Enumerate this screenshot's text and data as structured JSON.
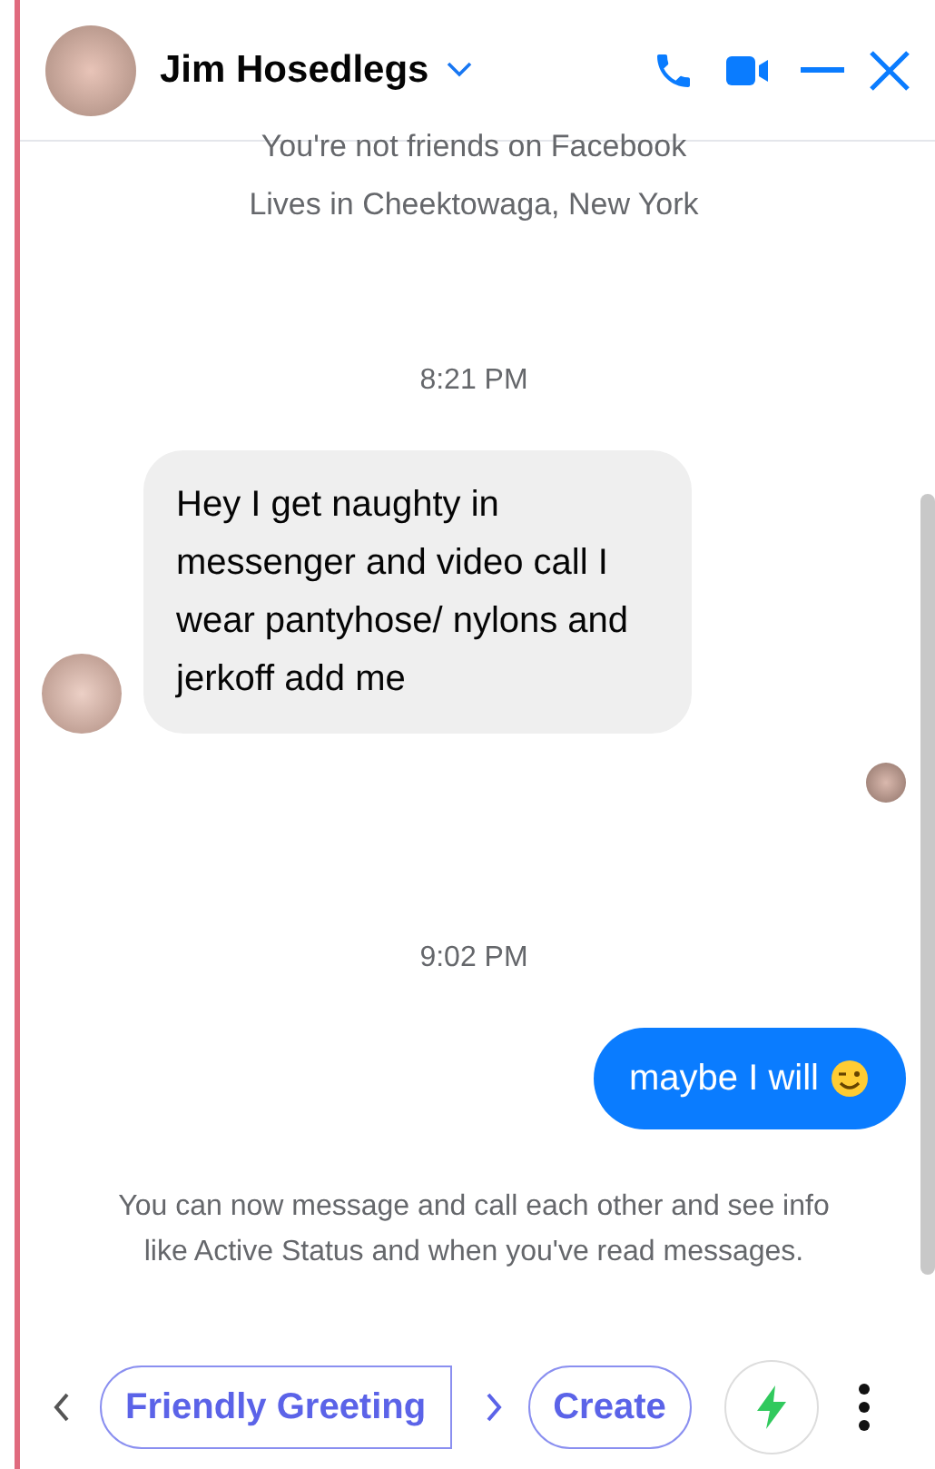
{
  "header": {
    "name": "Jim Hosedlegs"
  },
  "messages": [
    {
      "kind": "info",
      "text": "You're not friends on Facebook"
    },
    {
      "kind": "info",
      "text": "Lives in Cheektowaga, New York"
    },
    {
      "kind": "time",
      "text": "8:21 PM"
    },
    {
      "kind": "incoming",
      "text": "Hey I get naughty  in messenger and video call I wear pantyhose/ nylons and jerkoff add me"
    },
    {
      "kind": "seen"
    },
    {
      "kind": "time",
      "text": "9:02 PM"
    },
    {
      "kind": "outgoing",
      "text": "maybe I will"
    },
    {
      "kind": "notice",
      "text": "You can now message and call each other and see info like Active Status and when you've read messages."
    }
  ],
  "suggestions": [
    "Friendly Greeting",
    "Create"
  ]
}
